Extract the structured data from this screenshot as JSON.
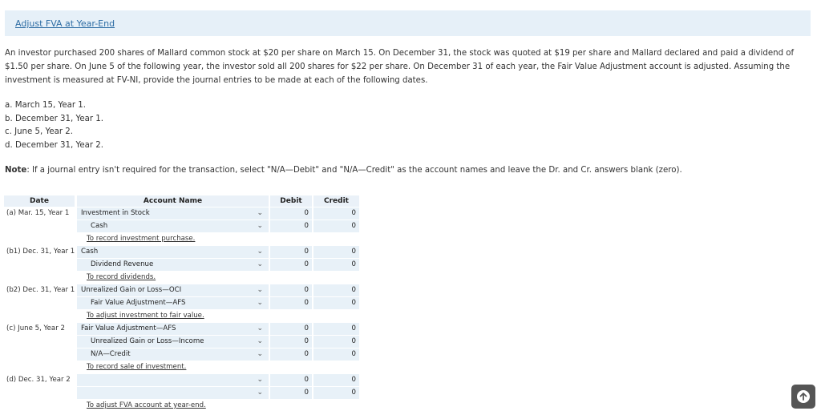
{
  "tab": {
    "label": "Adjust FVA at Year-End"
  },
  "problem": {
    "text": "An investor purchased 200 shares of Mallard common stock at $20 per share on March 15. On December 31, the stock was quoted at $19 per share and Mallard declared and paid a dividend of $1.50 per share. On June 5 of the following year, the investor sold all 200 shares for $22 per share. On December 31 of each year, the Fair Value Adjustment account is adjusted. Assuming the investment is measured at FV-NI, provide the journal entries to be made at each of the following dates."
  },
  "parts": [
    "a. March 15, Year 1.",
    "b. December 31, Year 1.",
    "c. June 5, Year 2.",
    "d. December 31, Year 2."
  ],
  "note": {
    "label": "Note",
    "text": ": If a journal entry isn't required for the transaction, select \"N/A—Debit\" and \"N/A—Credit\" as the account names and leave the Dr. and Cr. answers blank (zero)."
  },
  "table": {
    "headers": {
      "date": "Date",
      "account": "Account Name",
      "debit": "Debit",
      "credit": "Credit"
    },
    "rows": [
      {
        "date": "(a) Mar. 15, Year 1",
        "account": "Investment in Stock",
        "indent": false,
        "debit": "0",
        "credit": "0"
      },
      {
        "date": "",
        "account": "Cash",
        "indent": true,
        "debit": "0",
        "credit": "0"
      },
      {
        "date": "(b1) Dec. 31, Year 1",
        "account": "Cash",
        "indent": false,
        "debit": "0",
        "credit": "0"
      },
      {
        "date": "",
        "account": "Dividend Revenue",
        "indent": true,
        "debit": "0",
        "credit": "0"
      },
      {
        "date": "(b2) Dec. 31, Year 1",
        "account": "Unrealized Gain or Loss—OCI",
        "indent": false,
        "debit": "0",
        "credit": "0"
      },
      {
        "date": "",
        "account": "Fair Value Adjustment—AFS",
        "indent": true,
        "debit": "0",
        "credit": "0"
      },
      {
        "date": "(c) June 5, Year 2",
        "account": "Fair Value Adjustment—AFS",
        "indent": false,
        "debit": "0",
        "credit": "0"
      },
      {
        "date": "",
        "account": "Unrealized Gain or Loss—Income",
        "indent": true,
        "debit": "0",
        "credit": "0"
      },
      {
        "date": "",
        "account": "N/A—Credit",
        "indent": true,
        "debit": "0",
        "credit": "0"
      },
      {
        "date": "(d) Dec. 31, Year 2",
        "account": "",
        "indent": false,
        "debit": "0",
        "credit": "0"
      },
      {
        "date": "",
        "account": "",
        "indent": true,
        "debit": "0",
        "credit": "0"
      }
    ],
    "memos": [
      "To record investment purchase.",
      "To record dividends.",
      "To adjust investment to fair value.",
      "To record sale of investment.",
      "To adjust FVA account at year-end."
    ]
  },
  "icons": {
    "chevron": "chevron-down-icon",
    "scroll": "arrow-up-icon"
  }
}
